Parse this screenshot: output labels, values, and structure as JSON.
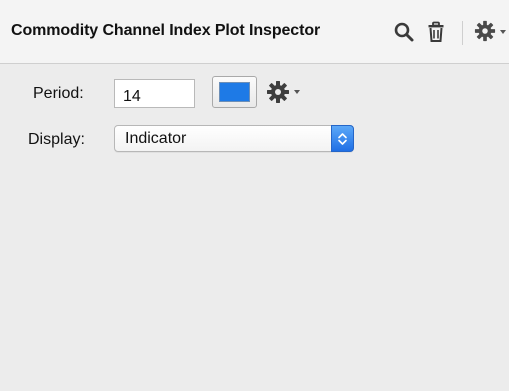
{
  "inspector": {
    "title": "Commodity Channel Index Plot Inspector",
    "icons": {
      "search": "search-icon",
      "trash": "trash-icon",
      "gear": "gear-icon"
    }
  },
  "fields": {
    "period_label": "Period:",
    "period_value": "14",
    "display_label": "Display:",
    "display_value": "Indicator"
  },
  "colors": {
    "line_color": "#1e7ae6",
    "select_accent": "#2f82ee"
  }
}
